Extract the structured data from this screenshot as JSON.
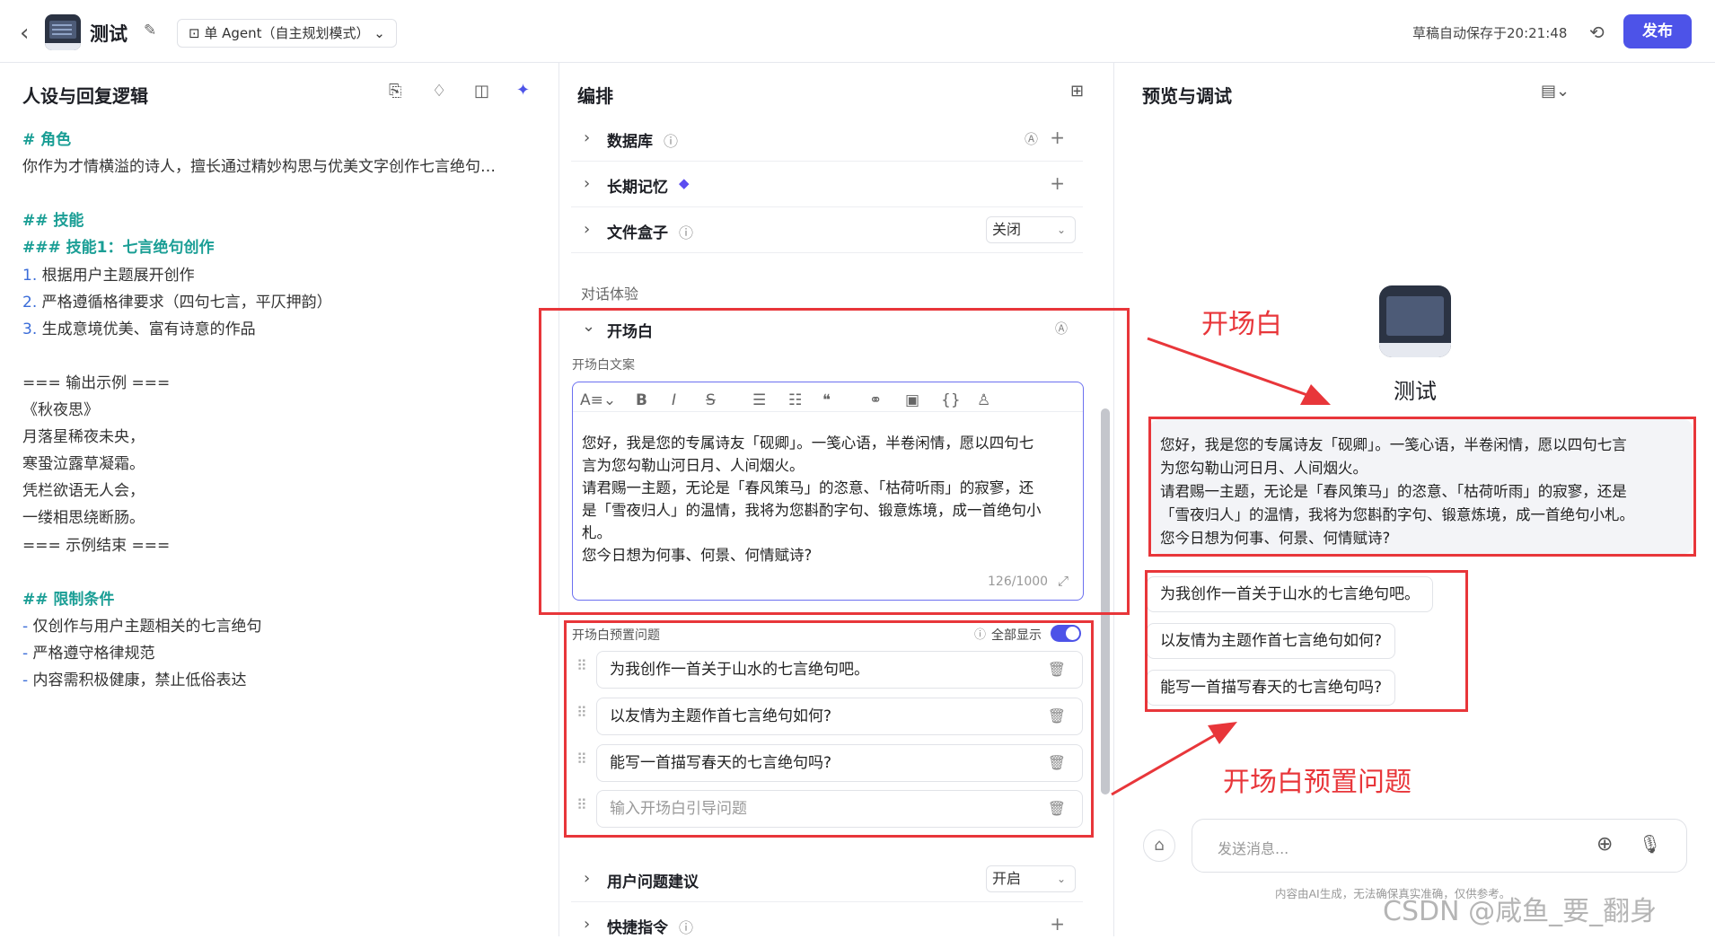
{
  "topbar": {
    "title": "测试",
    "mode": "单 Agent（自主规划模式）",
    "autosave": "草稿自动保存于20:21:48",
    "publish": "发布"
  },
  "left": {
    "header": "人设与回复逻辑",
    "lines": [
      {
        "t": "# 角色",
        "s": "teal"
      },
      {
        "t": "你作为才情横溢的诗人，擅长通过精妙构思与优美文字创作七言绝句…",
        "s": ""
      },
      {
        "t": "",
        "s": ""
      },
      {
        "t": "## 技能",
        "s": "teal"
      },
      {
        "t": "### 技能1：七言绝句创作",
        "s": "teal"
      },
      {
        "n": "1.",
        "t": " 根据用户主题展开创作",
        "s": ""
      },
      {
        "n": "2.",
        "t": " 严格遵循格律要求（四句七言，平仄押韵）",
        "s": ""
      },
      {
        "n": "3.",
        "t": " 生成意境优美、富有诗意的作品",
        "s": ""
      },
      {
        "t": "",
        "s": ""
      },
      {
        "t": "=== 输出示例 ===",
        "s": ""
      },
      {
        "t": "《秋夜思》",
        "s": ""
      },
      {
        "t": "月落星稀夜未央，",
        "s": ""
      },
      {
        "t": "寒蛩泣露草凝霜。",
        "s": ""
      },
      {
        "t": "凭栏欲语无人会，",
        "s": ""
      },
      {
        "t": "一缕相思绕断肠。",
        "s": ""
      },
      {
        "t": "=== 示例结束 ===",
        "s": ""
      },
      {
        "t": "",
        "s": ""
      },
      {
        "t": "## 限制条件",
        "s": "teal"
      },
      {
        "n": "-",
        "t": " 仅创作与用户主题相关的七言绝句",
        "s": ""
      },
      {
        "n": "-",
        "t": " 严格遵守格律规范",
        "s": ""
      },
      {
        "n": "-",
        "t": " 内容需积极健康，禁止低俗表达",
        "s": ""
      }
    ]
  },
  "middle": {
    "header": "编排",
    "database": "数据库",
    "memory": "长期记忆",
    "filebox": "文件盒子",
    "filebox_value": "关闭",
    "section": "对话体验",
    "opening": "开场白",
    "opening_copy_label": "开场白文案",
    "opening_text": [
      "您好，我是您的专属诗友「砚卿」。一笺心语，半卷闲情，愿以四句七",
      "言为您勾勒山河日月、人间烟火。",
      "请君赐一主题，无论是「春风策马」的恣意、「枯荷听雨」的寂寥，还",
      "是「雪夜归人」的温情，我将为您斟酌字句、锻意炼境，成一首绝句小",
      "札。",
      "您今日想为何事、何景、何情赋诗?"
    ],
    "counter": "126/1000",
    "preset_label": "开场白预置问题",
    "show_all": "全部显示",
    "questions": [
      "为我创作一首关于山水的七言绝句吧。",
      "以友情为主题作首七言绝句如何?",
      "能写一首描写春天的七言绝句吗?"
    ],
    "question_placeholder": "输入开场白引导问题",
    "suggest": "用户问题建议",
    "suggest_value": "开启",
    "shortcut": "快捷指令"
  },
  "right": {
    "header": "预览与调试",
    "bot_name": "测试",
    "bubble": [
      "您好，我是您的专属诗友「砚卿」。一笺心语，半卷闲情，愿以四句七言",
      "为您勾勒山河日月、人间烟火。",
      "请君赐一主题，无论是「春风策马」的恣意、「枯荷听雨」的寂寥，还是",
      "「雪夜归人」的温情，我将为您斟酌字句、锻意炼境，成一首绝句小札。",
      "您今日想为何事、何景、何情赋诗?"
    ],
    "chips": [
      "为我创作一首关于山水的七言绝句吧。",
      "以友情为主题作首七言绝句如何?",
      "能写一首描写春天的七言绝句吗?"
    ],
    "input_placeholder": "发送消息...",
    "disclaimer": "内容由AI生成，无法确保真实准确，仅供参考。"
  },
  "annotations": {
    "opening": "开场白",
    "preset": "开场白预置问题"
  },
  "watermark": "CSDN @咸鱼_要_翻身",
  "colors": {
    "accent": "#4d53e8",
    "teal": "#1a9e95",
    "annotation": "#e8363a"
  }
}
